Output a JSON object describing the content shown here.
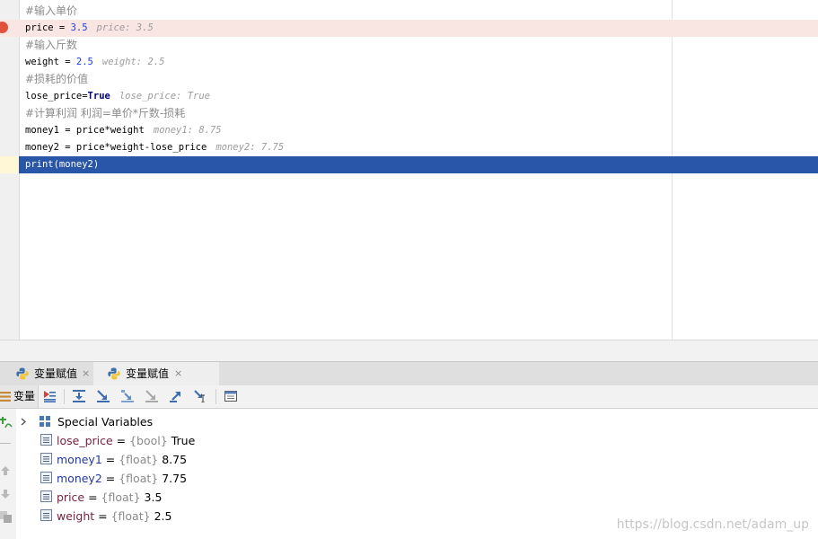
{
  "code": {
    "lines": [
      {
        "type": "comment",
        "text": "#输入单价"
      },
      {
        "type": "assign",
        "name": "price",
        "op": " = ",
        "value": "3.5",
        "value_kind": "num",
        "inline": "price: 3.5"
      },
      {
        "type": "comment",
        "text": "#输入斤数"
      },
      {
        "type": "assign",
        "name": "weight",
        "op": " = ",
        "value": "2.5",
        "value_kind": "num",
        "inline": "weight: 2.5"
      },
      {
        "type": "comment",
        "text": "#损耗的价值"
      },
      {
        "type": "assign",
        "name": "lose_price",
        "op": "=",
        "value": "True",
        "value_kind": "kw",
        "inline": "lose_price: True"
      },
      {
        "type": "comment",
        "text": "#计算利润 利润=单价*斤数-损耗"
      },
      {
        "type": "assign",
        "name": "money1",
        "op": " = ",
        "value": "price*weight",
        "value_kind": "plain",
        "inline": "money1: 8.75"
      },
      {
        "type": "assign",
        "name": "money2",
        "op": " = ",
        "value": "price*weight-lose_price",
        "value_kind": "plain",
        "inline": "money2: 7.75"
      },
      {
        "type": "plain",
        "text": "print(money2)"
      }
    ],
    "breakpoint_line": 1,
    "current_line": 9
  },
  "debug_tabs": [
    {
      "label": "变量赋值",
      "close": "×"
    },
    {
      "label": "变量赋值",
      "close": "×"
    }
  ],
  "toolbar": {
    "variables_label": "变量"
  },
  "variables": {
    "special": "Special Variables",
    "items": [
      {
        "name": "lose_price",
        "type": "{bool}",
        "value": "True"
      },
      {
        "name": "money1",
        "type": "{float}",
        "value": "8.75"
      },
      {
        "name": "money2",
        "type": "{float}",
        "value": "7.75"
      },
      {
        "name": "price",
        "type": "{float}",
        "value": "3.5"
      },
      {
        "name": "weight",
        "type": "{float}",
        "value": "2.5"
      }
    ]
  },
  "watermark": "https://blog.csdn.net/adam_up",
  "colors": {
    "current_line": "#2a56a9",
    "breakpoint": "#e0513d",
    "breakpoint_line": "#f9e6e3"
  },
  "icons": [
    "breakpoint-icon",
    "python-icon",
    "variables-icon",
    "show-execution-point-icon",
    "step-over-icon",
    "step-into-icon",
    "step-into-my-code-icon",
    "force-step-into-icon",
    "step-out-icon",
    "run-to-cursor-icon",
    "evaluate-expression-icon",
    "chevron-right-icon",
    "variable-icon",
    "new-watch-icon",
    "arrow-up-icon",
    "arrow-down-icon",
    "copy-icon"
  ]
}
